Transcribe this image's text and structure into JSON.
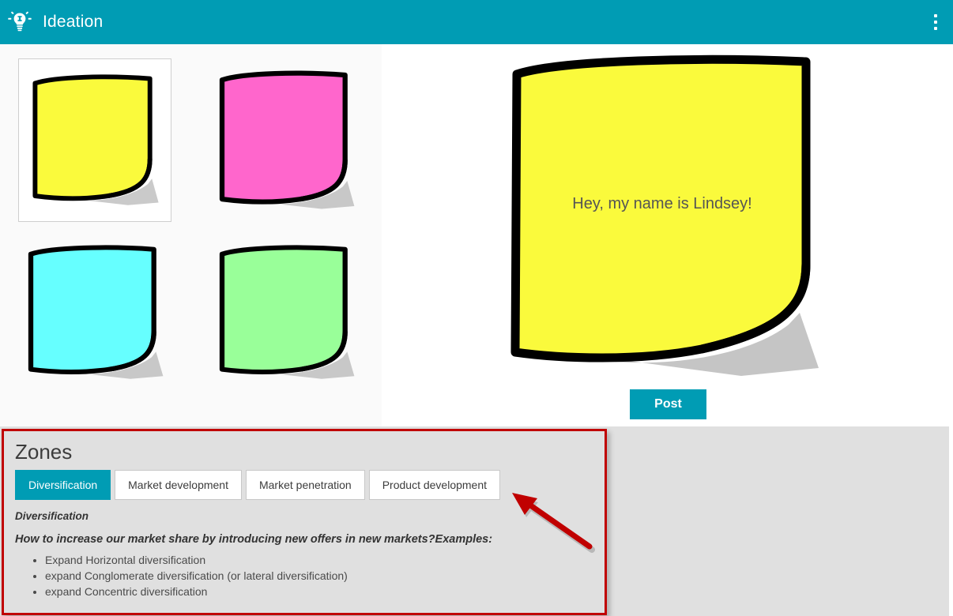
{
  "header": {
    "title": "Ideation",
    "logo_icon": "lightbulb-idea-icon",
    "menu_icon": "more-vertical-icon",
    "background_color": "#009cb4"
  },
  "palette": {
    "background_color": "#fafafa",
    "selected_index": 0,
    "notes": [
      {
        "color_name": "yellow",
        "color": "#FAFA3C",
        "selected": true
      },
      {
        "color_name": "pink",
        "color": "#FF66CC",
        "selected": false
      },
      {
        "color_name": "cyan",
        "color": "#66FFFF",
        "selected": false
      },
      {
        "color_name": "green",
        "color": "#99FF99",
        "selected": false
      }
    ]
  },
  "canvas": {
    "note": {
      "color": "#FAFA3C",
      "text": "Hey, my name is Lindsey!",
      "text_color": "#555555"
    },
    "post_button": {
      "label": "Post",
      "color": "#009cb4"
    }
  },
  "zones": {
    "title": "Zones",
    "border_color": "#c00000",
    "background_color": "#e0e0e0",
    "accent_color": "#009cb4",
    "tabs": [
      {
        "label": "Diversification",
        "active": true
      },
      {
        "label": "Market development",
        "active": false
      },
      {
        "label": "Market penetration",
        "active": false
      },
      {
        "label": "Product development",
        "active": false
      }
    ],
    "content": {
      "subtitle": "Diversification",
      "question": "How to increase our market share by introducing new offers in new markets?Examples:",
      "bullets": [
        "Expand Horizontal diversification",
        "expand Conglomerate diversification (or lateral diversification)",
        "expand Concentric diversification"
      ]
    }
  },
  "annotation": {
    "arrow_icon": "red-arrow-pointer",
    "color": "#c00000",
    "points_to": "Product development"
  }
}
